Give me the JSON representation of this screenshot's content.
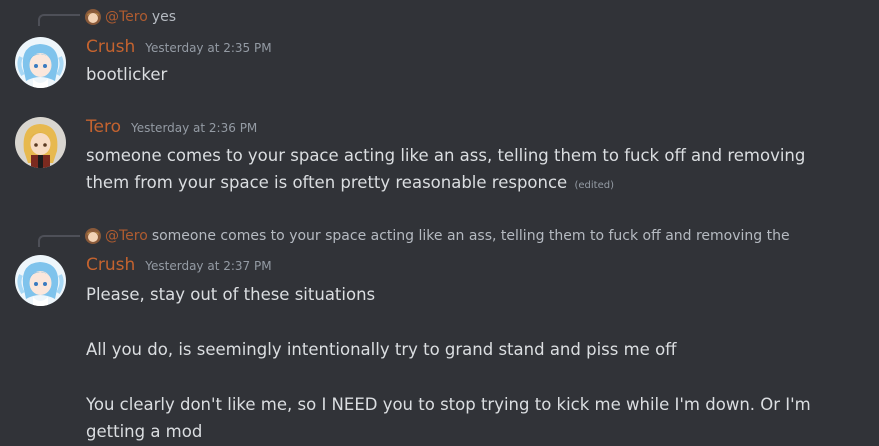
{
  "messages": [
    {
      "reply": {
        "mention": "@Tero",
        "text": "yes"
      },
      "author": "Crush",
      "timestamp": "Yesterday at 2:35 PM",
      "avatar_icon": "anime-girl-blue-hair-avatar",
      "lines": [
        "bootlicker"
      ]
    },
    {
      "author": "Tero",
      "timestamp": "Yesterday at 2:36 PM",
      "avatar_icon": "anime-girl-blonde-hair-avatar",
      "lines": [
        "someone comes to your space acting like an ass, telling them to fuck off and removing them from your space is often pretty reasonable responce"
      ],
      "edited_label": "(edited)"
    },
    {
      "reply": {
        "mention": "@Tero",
        "text": "someone comes to your space acting like an ass, telling them to fuck off and removing the"
      },
      "author": "Crush",
      "timestamp": "Yesterday at 2:37 PM",
      "avatar_icon": "anime-girl-blue-hair-avatar",
      "lines": [
        "Please, stay out of these situations",
        "All you do, is seemingly intentionally try to grand stand and piss me off",
        "You clearly don't like me, so I NEED you to stop trying to kick me while I'm down. Or I'm getting a mod"
      ]
    }
  ],
  "colors": {
    "background": "#313338",
    "username": "#c4632f",
    "text": "#dbdee1",
    "muted": "#949ba4"
  }
}
